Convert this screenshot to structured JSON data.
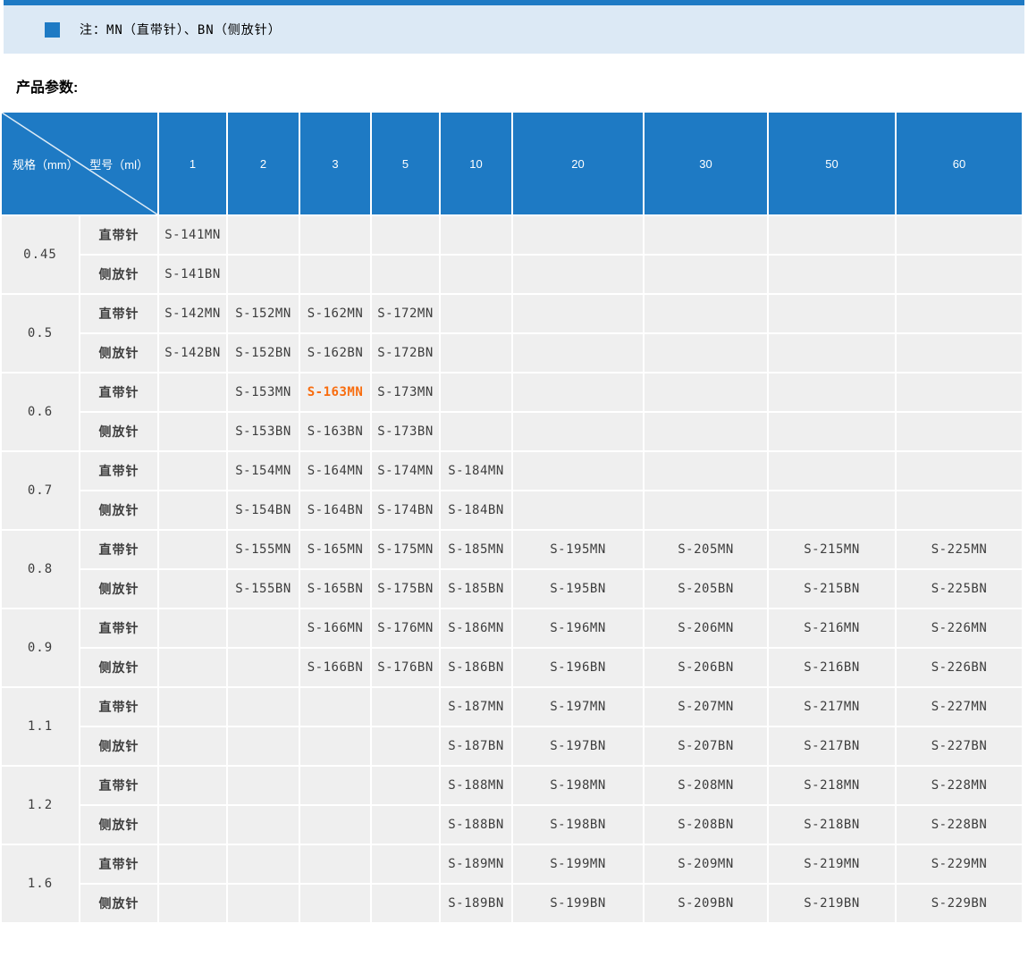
{
  "colors": {
    "accent_blue": "#1e7ac4",
    "band_bg": "#dce9f5",
    "cell_bg": "#efefef",
    "cell_text": "#3d3d3d",
    "highlight_orange": "#f86c0e",
    "grid_white": "#ffffff"
  },
  "note": {
    "bullet_icon": "square-bullet-icon",
    "text": "注：MN（直带针）、BN（侧放针）"
  },
  "section_title": "产品参数:",
  "table": {
    "corner": {
      "spec_label": "规格（mm）",
      "model_label": "型号（ml）"
    },
    "columns": [
      "1",
      "2",
      "3",
      "5",
      "10",
      "20",
      "30",
      "50",
      "60"
    ],
    "row_types": [
      "直带针",
      "侧放针"
    ],
    "highlight": {
      "model": "S-163MN",
      "color": "#f86c0e"
    },
    "groups": [
      {
        "spec": "0.45",
        "mn": [
          "S-141MN",
          "",
          "",
          "",
          "",
          "",
          "",
          "",
          ""
        ],
        "bn": [
          "S-141BN",
          "",
          "",
          "",
          "",
          "",
          "",
          "",
          ""
        ]
      },
      {
        "spec": "0.5",
        "mn": [
          "S-142MN",
          "S-152MN",
          "S-162MN",
          "S-172MN",
          "",
          "",
          "",
          "",
          ""
        ],
        "bn": [
          "S-142BN",
          "S-152BN",
          "S-162BN",
          "S-172BN",
          "",
          "",
          "",
          "",
          ""
        ]
      },
      {
        "spec": "0.6",
        "mn": [
          "",
          "S-153MN",
          "S-163MN",
          "S-173MN",
          "",
          "",
          "",
          "",
          ""
        ],
        "bn": [
          "",
          "S-153BN",
          "S-163BN",
          "S-173BN",
          "",
          "",
          "",
          "",
          ""
        ]
      },
      {
        "spec": "0.7",
        "mn": [
          "",
          "S-154MN",
          "S-164MN",
          "S-174MN",
          "S-184MN",
          "",
          "",
          "",
          ""
        ],
        "bn": [
          "",
          "S-154BN",
          "S-164BN",
          "S-174BN",
          "S-184BN",
          "",
          "",
          "",
          ""
        ]
      },
      {
        "spec": "0.8",
        "mn": [
          "",
          "S-155MN",
          "S-165MN",
          "S-175MN",
          "S-185MN",
          "S-195MN",
          "S-205MN",
          "S-215MN",
          "S-225MN"
        ],
        "bn": [
          "",
          "S-155BN",
          "S-165BN",
          "S-175BN",
          "S-185BN",
          "S-195BN",
          "S-205BN",
          "S-215BN",
          "S-225BN"
        ]
      },
      {
        "spec": "0.9",
        "mn": [
          "",
          "",
          "S-166MN",
          "S-176MN",
          "S-186MN",
          "S-196MN",
          "S-206MN",
          "S-216MN",
          "S-226MN"
        ],
        "bn": [
          "",
          "",
          "S-166BN",
          "S-176BN",
          "S-186BN",
          "S-196BN",
          "S-206BN",
          "S-216BN",
          "S-226BN"
        ]
      },
      {
        "spec": "1.1",
        "mn": [
          "",
          "",
          "",
          "",
          "S-187MN",
          "S-197MN",
          "S-207MN",
          "S-217MN",
          "S-227MN"
        ],
        "bn": [
          "",
          "",
          "",
          "",
          "S-187BN",
          "S-197BN",
          "S-207BN",
          "S-217BN",
          "S-227BN"
        ]
      },
      {
        "spec": "1.2",
        "mn": [
          "",
          "",
          "",
          "",
          "S-188MN",
          "S-198MN",
          "S-208MN",
          "S-218MN",
          "S-228MN"
        ],
        "bn": [
          "",
          "",
          "",
          "",
          "S-188BN",
          "S-198BN",
          "S-208BN",
          "S-218BN",
          "S-228BN"
        ]
      },
      {
        "spec": "1.6",
        "mn": [
          "",
          "",
          "",
          "",
          "S-189MN",
          "S-199MN",
          "S-209MN",
          "S-219MN",
          "S-229MN"
        ],
        "bn": [
          "",
          "",
          "",
          "",
          "S-189BN",
          "S-199BN",
          "S-209BN",
          "S-219BN",
          "S-229BN"
        ]
      }
    ]
  }
}
